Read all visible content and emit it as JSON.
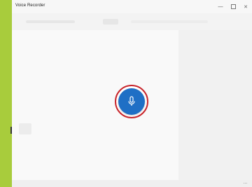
{
  "window": {
    "title": "Voice Recorder"
  },
  "controls": {
    "minimize": "—",
    "close": "✕"
  },
  "record": {
    "icon": "microphone-icon",
    "accent_color": "#1f6fc5",
    "highlight_color": "#c8262c"
  },
  "footer": {
    "more": "..."
  }
}
